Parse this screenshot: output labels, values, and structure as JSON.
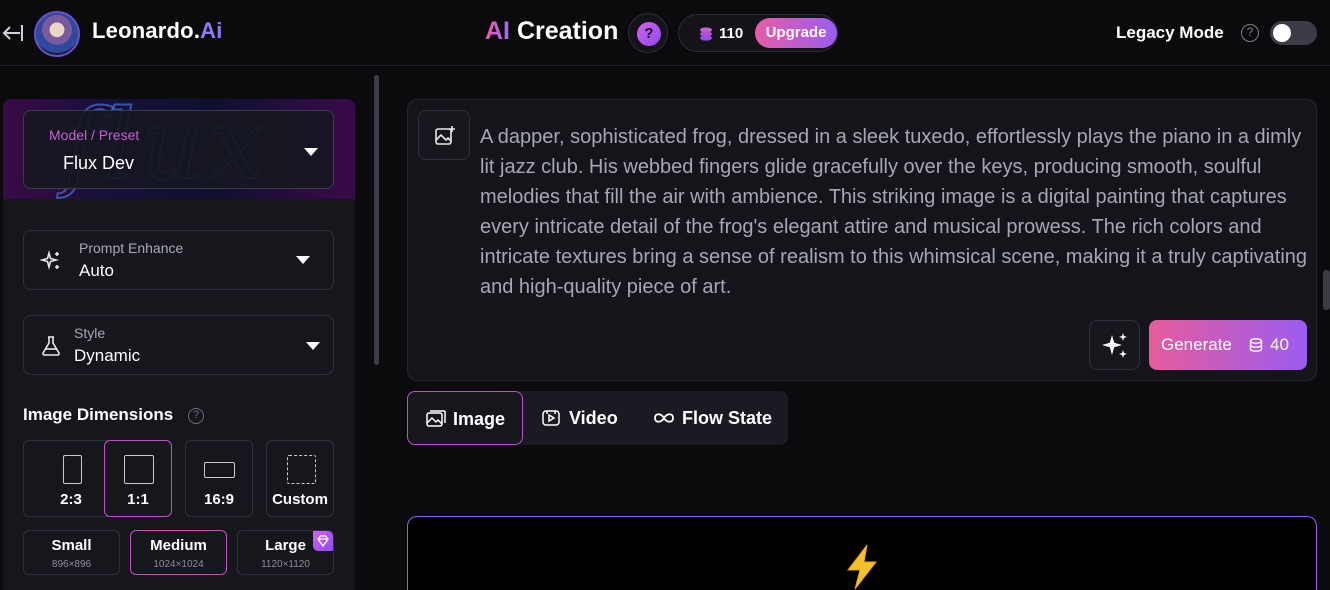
{
  "header": {
    "brand_name": "Leonardo.",
    "brand_suffix": "Ai",
    "title_ai": "AI",
    "title_rest": " Creation",
    "help_glyph": "?",
    "credits": "110",
    "upgrade_label": "Upgrade",
    "legacy_label": "Legacy Mode",
    "legacy_help_glyph": "?",
    "legacy_enabled": false
  },
  "sidebar": {
    "model_label": "Model / Preset",
    "model_value": "Flux Dev",
    "banner_word": "flux",
    "prompt_enhance_label": "Prompt Enhance",
    "prompt_enhance_value": "Auto",
    "style_label": "Style",
    "style_value": "Dynamic",
    "dimensions_title": "Image Dimensions",
    "dimensions_help_glyph": "?",
    "ratios": [
      {
        "label": "2:3",
        "active": false
      },
      {
        "label": "1:1",
        "active": true
      },
      {
        "label": "16:9",
        "active": false
      },
      {
        "label": "Custom",
        "active": false
      }
    ],
    "sizes": [
      {
        "label": "Small",
        "dims": "896×896",
        "active": false
      },
      {
        "label": "Medium",
        "dims": "1024×1024",
        "active": true
      },
      {
        "label": "Large",
        "dims": "1120×1120",
        "active": false,
        "premium": true
      }
    ]
  },
  "prompt": {
    "text": "A dapper, sophisticated frog, dressed in a sleek tuxedo, effortlessly plays the piano in a dimly lit jazz club. His webbed fingers glide gracefully over the keys, producing smooth, soulful melodies that fill the air with ambience. This striking image is a digital painting that captures every intricate detail of the frog's elegant attire and musical prowess. The rich colors and intricate textures bring a sense of realism to this whimsical scene, making it a truly captivating and high-quality piece of art.",
    "generate_label": "Generate",
    "generate_cost": "40"
  },
  "tabs": [
    {
      "label": "Image",
      "active": true
    },
    {
      "label": "Video",
      "active": false
    },
    {
      "label": "Flow State",
      "active": false
    }
  ],
  "colors": {
    "accent_pink": "#e65c9c",
    "accent_purple": "#9b5cf0",
    "background": "#0b0b0e"
  },
  "icons": {
    "back": "arrow-left-bar-icon",
    "coins": "coins-icon",
    "prompt_image": "image-plus-icon",
    "magic": "sparkles-icon",
    "image_tab": "images-icon",
    "video_tab": "video-icon",
    "flow_tab": "infinity-icon",
    "bolt": "lightning-bolt-icon"
  }
}
